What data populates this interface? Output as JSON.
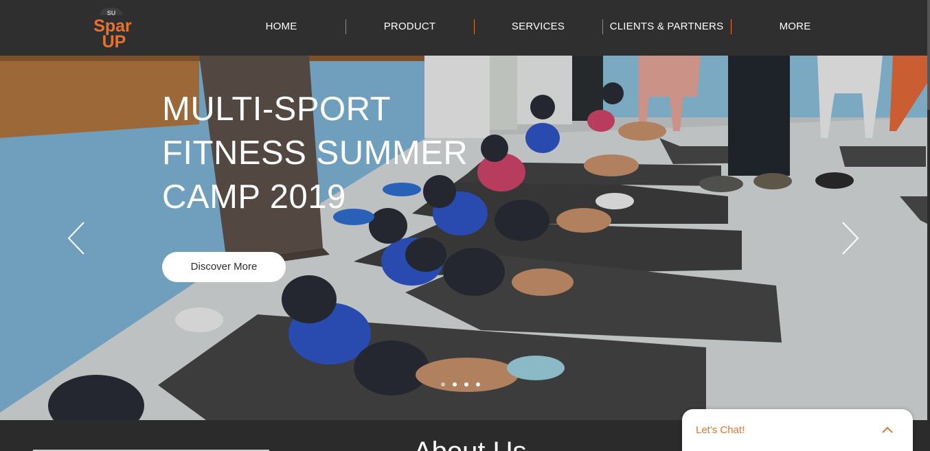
{
  "brand": {
    "logo_badge": "SU",
    "logo_line1": "Spar",
    "logo_line2": "UP",
    "accent_color": "#e8722d"
  },
  "nav": {
    "items": [
      {
        "label": "HOME"
      },
      {
        "label": "PRODUCT"
      },
      {
        "label": "SERVICES"
      },
      {
        "label": "CLIENTS & PARTNERS"
      },
      {
        "label": "MORE"
      }
    ]
  },
  "hero": {
    "title_lines": [
      "MULTI-SPORT",
      "FITNESS SUMMER",
      "CAMP 2019"
    ],
    "cta_label": "Discover More",
    "prev_icon": "chevron-left-icon",
    "next_icon": "chevron-right-icon",
    "slide_count": 4,
    "active_slide": 2
  },
  "about": {
    "title": "About Us"
  },
  "chat": {
    "label": "Let's Chat!",
    "icon": "chevron-up-icon"
  }
}
